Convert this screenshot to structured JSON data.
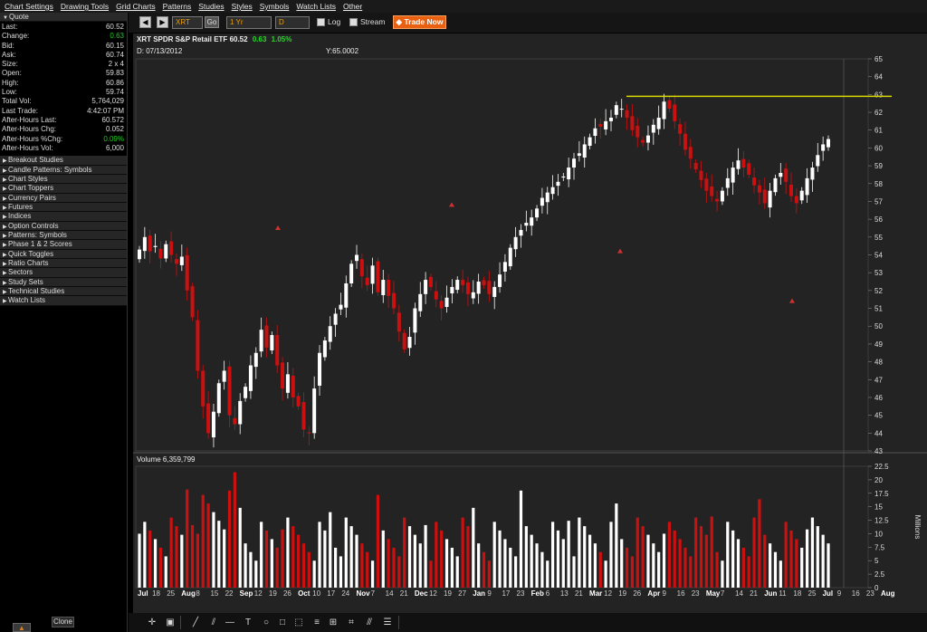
{
  "menu": [
    "Chart Settings",
    "Drawing Tools",
    "Grid Charts",
    "Patterns",
    "Studies",
    "Styles",
    "Symbols",
    "Watch Lists",
    "Other"
  ],
  "quote": {
    "title": "Quote",
    "rows": [
      {
        "label": "Last:",
        "value": "60.52",
        "color": ""
      },
      {
        "label": "Change:",
        "value": "0.63",
        "color": "green"
      },
      {
        "label": "Bid:",
        "value": "60.15",
        "color": ""
      },
      {
        "label": "Ask:",
        "value": "60.74",
        "color": ""
      },
      {
        "label": "Size:",
        "value": "2 x 4",
        "color": ""
      },
      {
        "label": "Open:",
        "value": "59.83",
        "color": ""
      },
      {
        "label": "High:",
        "value": "60.86",
        "color": ""
      },
      {
        "label": "Low:",
        "value": "59.74",
        "color": ""
      },
      {
        "label": "Total Vol:",
        "value": "5,764,029",
        "color": ""
      },
      {
        "label": "Last Trade:",
        "value": "4:42:07 PM",
        "color": ""
      },
      {
        "label": "After-Hours Last:",
        "value": "60.572",
        "color": ""
      },
      {
        "label": "After-Hours Chg:",
        "value": "0.052",
        "color": ""
      },
      {
        "label": "After-Hours %Chg:",
        "value": "0.09%",
        "color": "green"
      },
      {
        "label": "After-Hours Vol:",
        "value": "6,000",
        "color": ""
      }
    ]
  },
  "sections": [
    "Breakout Studies",
    "Candle Patterns: Symbols",
    "Chart Styles",
    "Chart Toppers",
    "Currency Pairs",
    "Futures",
    "Indices",
    "Option Controls",
    "Patterns: Symbols",
    "Phase 1 & 2 Scores",
    "Quick Toggles",
    "Ratio Charts",
    "Sectors",
    "Study Sets",
    "Technical Studies",
    "Watch Lists"
  ],
  "clone_label": "Clone",
  "toolbar": {
    "back": "◀",
    "forward": "▶",
    "symbol": "XRT",
    "go": "Go",
    "period": "1 Yr",
    "interval": "D",
    "log": "Log",
    "stream": "Stream",
    "trade_now": "Trade Now"
  },
  "chart_header": {
    "name": "XRT SPDR S&P Retail ETF",
    "last": "60.52",
    "change": "0.63",
    "pct": "1.05%",
    "date": "D: 07/13/2012",
    "y": "Y:65.0002",
    "volume": "Volume 6,359,799"
  },
  "colors": {
    "up": "#ffffff",
    "down": "#cc1010",
    "hline": "#d8d800",
    "marker": "#d03030",
    "background": "#232323",
    "grid": "#3a3a3a"
  },
  "bottom_tools": [
    "cursor-icon",
    "zoom-box-icon",
    "pencil-icon",
    "trendline-icon",
    "line-icon",
    "text-icon",
    "ellipse-icon",
    "rectangle-icon",
    "arrow-icon",
    "fibonacci-icon",
    "gann-icon",
    "andrews-icon",
    "speedlines-icon",
    "channels-icon"
  ],
  "chart_data": {
    "type": "candlestick",
    "title": "XRT SPDR S&P Retail ETF",
    "price_axis": {
      "min": 43,
      "max": 65,
      "ticks": [
        65,
        64,
        63,
        62,
        61,
        60,
        59,
        58,
        57,
        56,
        55,
        54,
        53,
        52,
        51,
        50,
        49,
        48,
        47,
        46,
        45,
        44,
        43
      ]
    },
    "volume_axis": {
      "min": 0,
      "max": 22.5,
      "ticks": [
        22.5,
        20,
        17.5,
        15,
        12.5,
        10,
        7.5,
        5,
        2.5,
        0
      ],
      "label": "Millions"
    },
    "x_labels": [
      "Jul",
      "18",
      "25",
      "Aug",
      "8",
      "15",
      "22",
      "Sep",
      "12",
      "19",
      "26",
      "Oct",
      "10",
      "17",
      "24",
      "Nov",
      "7",
      "14",
      "21",
      "Dec",
      "12",
      "19",
      "27",
      "Jan",
      "9",
      "17",
      "23",
      "Feb",
      "6",
      "13",
      "21",
      "Mar",
      "12",
      "19",
      "26",
      "Apr",
      "9",
      "16",
      "23",
      "May",
      "7",
      "14",
      "21",
      "Jun",
      "11",
      "18",
      "25",
      "Jul",
      "9",
      "16",
      "23",
      "Aug"
    ],
    "horizontal_line": 62.9,
    "markers_y": [
      55.5,
      56.8,
      54.2,
      51.4
    ],
    "closes": [
      54.3,
      55.0,
      54.2,
      54.5,
      53.8,
      54.6,
      54.0,
      53.5,
      53.9,
      52.0,
      50.5,
      47.5,
      45.5,
      44.0,
      45.2,
      46.8,
      47.5,
      45.0,
      44.5,
      45.8,
      46.6,
      47.8,
      48.5,
      49.8,
      48.8,
      49.5,
      47.8,
      46.5,
      47.3,
      46.0,
      45.5,
      44.2,
      44.0,
      46.5,
      48.5,
      49.2,
      50.0,
      50.7,
      51.2,
      52.4,
      53.5,
      54.0,
      52.8,
      52.3,
      53.4,
      51.9,
      52.6,
      51.7,
      51.0,
      49.7,
      48.7,
      49.4,
      51.0,
      51.8,
      52.6,
      52.2,
      51.5,
      51.0,
      51.6,
      52.2,
      52.6,
      52.3,
      51.8,
      51.9,
      52.5,
      52.3,
      51.8,
      52.2,
      52.9,
      53.6,
      54.4,
      55.0,
      55.4,
      55.8,
      56.1,
      56.6,
      57.2,
      57.5,
      57.8,
      58.1,
      58.4,
      58.9,
      59.4,
      59.7,
      60.2,
      60.6,
      61.1,
      61.2,
      61.5,
      61.7,
      62.4,
      62.2,
      61.7,
      61.0,
      60.6,
      60.3,
      60.7,
      61.3,
      61.7,
      62.6,
      62.2,
      61.5,
      60.8,
      59.9,
      59.4,
      58.8,
      58.2,
      57.6,
      57.3,
      57.0,
      57.6,
      58.3,
      58.9,
      59.3,
      58.9,
      58.5,
      57.9,
      57.5,
      56.9,
      57.6,
      58.3,
      58.6,
      58.1,
      57.3,
      56.9,
      57.6,
      58.3,
      58.9,
      59.6,
      60.2,
      60.5
    ]
  }
}
